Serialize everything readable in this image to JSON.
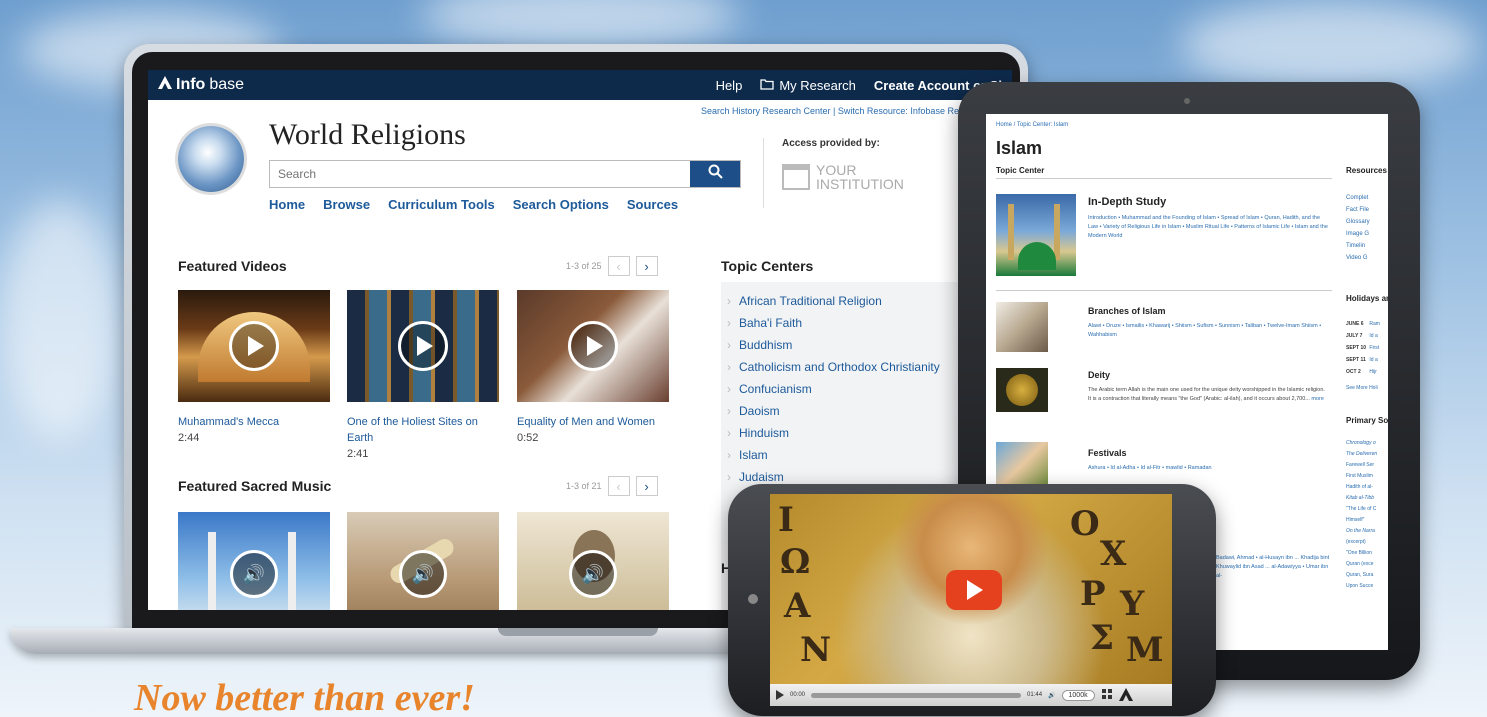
{
  "colors": {
    "infobase_navy": "#0e2a4b",
    "link_blue": "#1d5a9a",
    "tagline_orange": "#e8842c",
    "play_red": "#e5411f"
  },
  "laptop": {
    "topbar": {
      "logo_bold": "Info",
      "logo_thin": "base",
      "help": "Help",
      "my_research": "My Research",
      "create_account": "Create Account or Si"
    },
    "sublinks": "Search History Research Center  |  Switch Resource: Infobase Resc",
    "title": "World Religions",
    "search_placeholder": "Search",
    "nav": [
      "Home",
      "Browse",
      "Curriculum Tools",
      "Search Options",
      "Sources"
    ],
    "access_label": "Access provided by:",
    "institution_line1": "YOUR",
    "institution_line2": "INSTITUTION",
    "featured_videos": {
      "heading": "Featured Videos",
      "count": "1-3 of 25",
      "items": [
        {
          "title": "Muhammad's Mecca",
          "duration": "2:44"
        },
        {
          "title": "One of the Holiest Sites on Earth",
          "duration": "2:41"
        },
        {
          "title": "Equality of Men and Women",
          "duration": "0:52"
        }
      ]
    },
    "featured_music": {
      "heading": "Featured Sacred Music",
      "count": "1-3 of 21"
    },
    "topic_centers": {
      "heading": "Topic Centers",
      "items": [
        "African Traditional Religion",
        "Baha'i Faith",
        "Buddhism",
        "Catholicism and Orthodox Christianity",
        "Confucianism",
        "Daoism",
        "Hinduism",
        "Islam",
        "Judaism"
      ],
      "partial_heading": "H"
    }
  },
  "tablet": {
    "breadcrumb": "Home / Topic Center: Islam",
    "title": "Islam",
    "subtitle": "Topic Center",
    "in_depth": {
      "heading": "In-Depth Study",
      "text": "Introduction • Muhammad and the Founding of Islam • Spread of Islam • Quran, Hadith, and the Law • Variety of Religious Life in Islam • Muslim Ritual Life • Patterns of Islamic Life • Islam and the Modern World"
    },
    "branches": {
      "heading": "Branches of Islam",
      "text": "Alawi • Druze • Ismailis • Khawarij • Shiism • Sufism • Sunnism • Taliban • Twelve-Imam Shiism • Wahhabism"
    },
    "deity": {
      "heading": "Deity",
      "text": "The Arabic term Allah is the main one used for the unique deity worshipped in the Islamic religion. It is a contraction that literally means \"the God\" (Arabic: al-ilah), and it occurs about 2,700...",
      "more": "more"
    },
    "festivals": {
      "heading": "Festivals",
      "text": "Ashura • Id al-Adha • Id al-Fitr • mawlid • Ramadan"
    },
    "people_partial": "Badawi, Ahmad • al-Husayn ibn ... Khadija bint Khuwaylid ibn Asad ... al-Adawiyya • Umar ibn al-",
    "resources": {
      "heading": "Resources",
      "items": [
        "Complet",
        "Fact File",
        "Glossary",
        "Image G",
        "Timelin",
        "Video G"
      ]
    },
    "holidays": {
      "heading": "Holidays an",
      "items": [
        {
          "date": "JUNE 6",
          "name": "Ram"
        },
        {
          "date": "JULY 7",
          "name": "Id a"
        },
        {
          "date": "SEPT 10",
          "name": "First"
        },
        {
          "date": "SEPT 11",
          "name": "Id a"
        },
        {
          "date": "OCT 2",
          "name": "Hijr"
        }
      ],
      "see_more": "See More Holi"
    },
    "primary_sources": {
      "heading": "Primary Sou",
      "items": [
        "Chronology o",
        "The Deliveren",
        "Farewell Ser",
        "First Muslim",
        "Hadith of al-",
        "Kitab al-Tibb",
        "\"The Life of C",
        "Himself\"",
        "On the Narra",
        "(excerpt)",
        "\"One Billion",
        "Quran (exce",
        "Quran, Sura",
        "Upon Succe"
      ]
    }
  },
  "phone": {
    "mosaic_letters": [
      "Ι",
      "Ω",
      "Α",
      "Ν",
      "Ο",
      "Χ",
      "Ρ",
      "Υ",
      "Σ",
      "Μ"
    ],
    "time_elapsed": "00:00",
    "time_total": "01:44",
    "progress": 0.0,
    "quality": "1000k"
  },
  "tagline": "Now better than ever!"
}
